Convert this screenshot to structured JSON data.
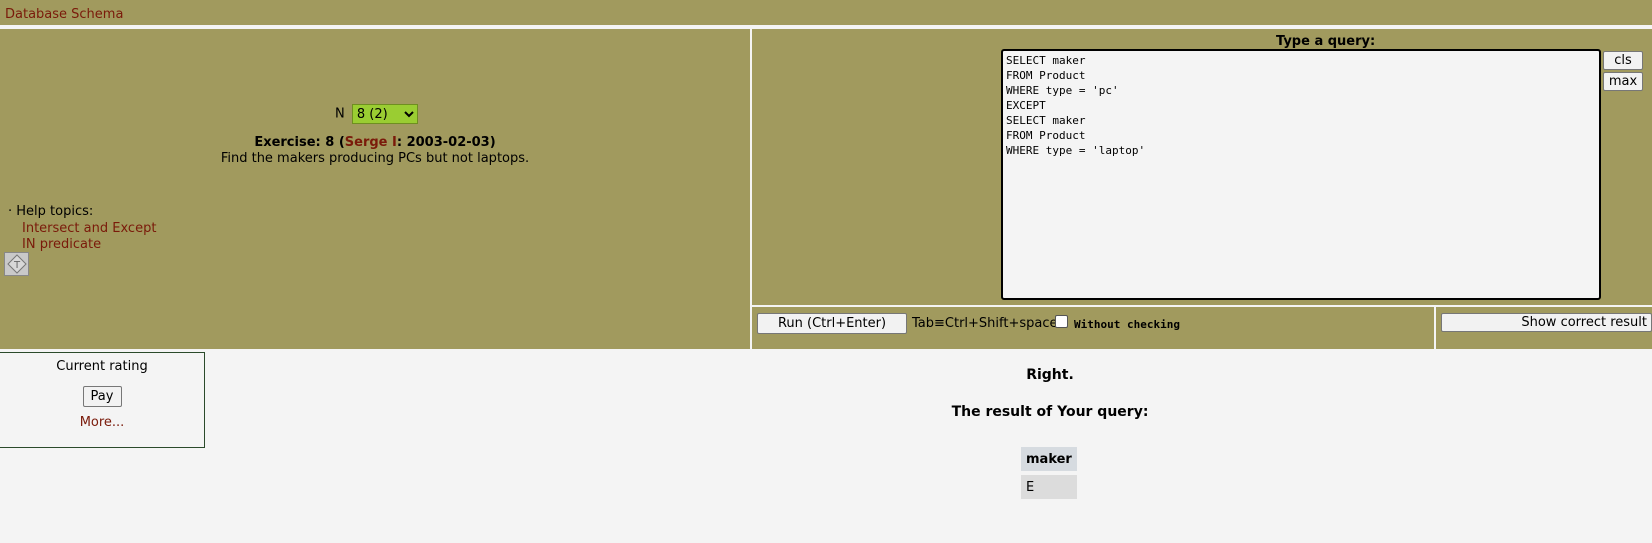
{
  "header": {
    "schema_link": "Database Schema"
  },
  "exercise_panel": {
    "n_label": "N",
    "n_selected": "8 (2)",
    "exercise_prefix": "Exercise: 8 (",
    "author": "Serge I",
    "exercise_suffix": ": 2003-02-03)",
    "task": "Find the makers producing PCs but not laptops.",
    "help_title": "· Help topics:",
    "help_links": [
      "Intersect and Except",
      "IN predicate"
    ]
  },
  "query_panel": {
    "label": "Type a query:",
    "query": "SELECT maker\nFROM Product\nWHERE type = 'pc'\nEXCEPT\nSELECT maker\nFROM Product\nWHERE type = 'laptop'",
    "cls_label": "cls",
    "max_label": "max"
  },
  "run_bar": {
    "run_label": "Run (Ctrl+Enter)",
    "tab_hint": "Tab≡Ctrl+Shift+space",
    "without_checking_label": "Without checking",
    "without_checking_checked": false,
    "show_correct_label": "Show correct result"
  },
  "rating": {
    "title": "Current rating",
    "pay_label": "Pay",
    "more_label": "More..."
  },
  "result": {
    "status": "Right.",
    "title": "The result of Your query:",
    "columns": [
      "maker"
    ],
    "rows": [
      [
        "E"
      ]
    ]
  },
  "colors": {
    "panel": "#a19a5e",
    "link": "#7a1a0a",
    "select_bg": "#9acd32"
  }
}
